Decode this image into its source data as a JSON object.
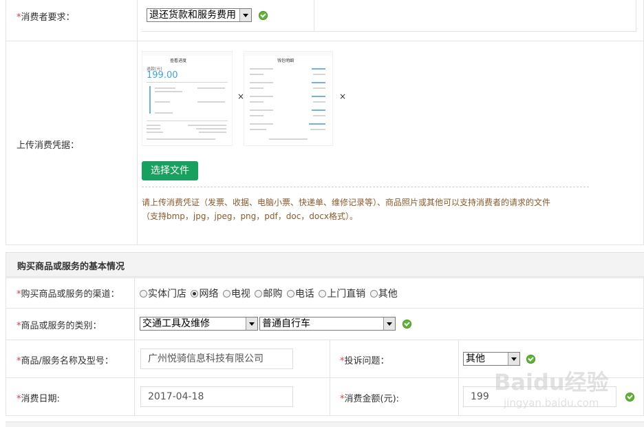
{
  "consumer_request": {
    "label_star": "*",
    "label": "消费者要求：",
    "selected": "退还货款和服务费用"
  },
  "upload": {
    "label": "上传消费凭据：",
    "button": "选择文件",
    "note_line1": "请上传消费凭证（发票、收据、电脑小票、快递单、维修记录等）、商品照片或其他可以支持消费者的请求的文件",
    "note_line2": "（支持bmp，jpg，jpeg，png，pdf，doc，docx格式）。",
    "thumbnails": [
      {
        "title": "查看进度",
        "amount": "199.00",
        "amount_label": "退款(元)"
      },
      {
        "title": "钱包明细"
      }
    ],
    "remove_icon": "×"
  },
  "section": {
    "title": "购买商品或服务的基本情况"
  },
  "channel": {
    "label_star": "*",
    "label": "购买商品或服务的渠道：",
    "options": [
      "实体门店",
      "网络",
      "电视",
      "邮购",
      "电话",
      "上门直销",
      "其他"
    ],
    "selected_index": 1
  },
  "category": {
    "label_star": "*",
    "label": "商品或服务的类别：",
    "primary": "交通工具及维修",
    "secondary": "普通自行车"
  },
  "product": {
    "label_star": "*",
    "label": "商品/服务名称及型号：",
    "value": "广州悦骑信息科技有限公司"
  },
  "complaint": {
    "label_star": "*",
    "label": "投诉问题：",
    "selected": "其他"
  },
  "date": {
    "label_star": "*",
    "label": "消费日期:",
    "value": "2017-04-18"
  },
  "amount": {
    "label_star": "*",
    "label": "消费金额(元):",
    "value": "199"
  },
  "watermark": {
    "text": "Baidu经验",
    "url": "jingyan.baidu.com"
  }
}
